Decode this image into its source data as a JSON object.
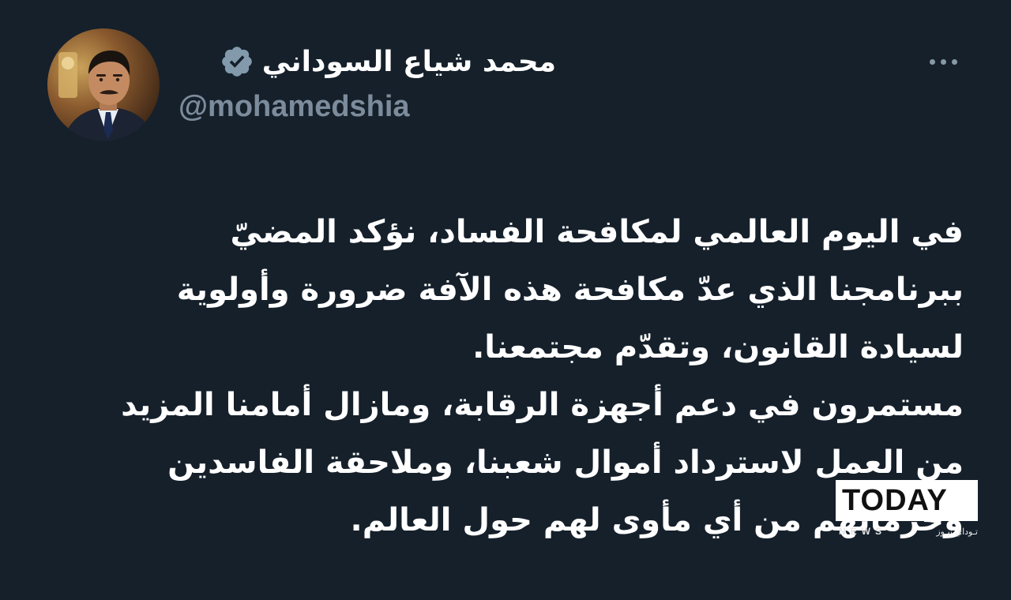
{
  "profile": {
    "display_name": "محمد شياع السوداني",
    "handle": "@mohamedshia",
    "verified_icon": "verified-badge-icon",
    "avatar_icon": "profile-photo"
  },
  "menu": {
    "more_icon": "more-horizontal-icon"
  },
  "tweet": {
    "lines": [
      "في اليوم العالمي لمكافحة الفساد، نؤكد المضيّ",
      "ببرنامجنا الذي عدّ مكافحة هذه الآفة ضرورة وأولوية",
      "لسيادة القانون، وتقدّم مجتمعنا.",
      "مستمرون في دعم أجهزة الرقابة، ومازال أمامنا المزيد",
      "من العمل لاسترداد أموال شعبنا، وملاحقة الفاسدين",
      "وحرمانهم من أي مأوى لهم حول العالم."
    ]
  },
  "watermark": {
    "word": "TODAY",
    "sub_en": "NEWS",
    "sub_ar": "تـوداي نيـوز"
  },
  "colors": {
    "background": "#15202b",
    "text": "#ffffff",
    "secondary": "#7c8c9c",
    "verified": "#829aab"
  }
}
